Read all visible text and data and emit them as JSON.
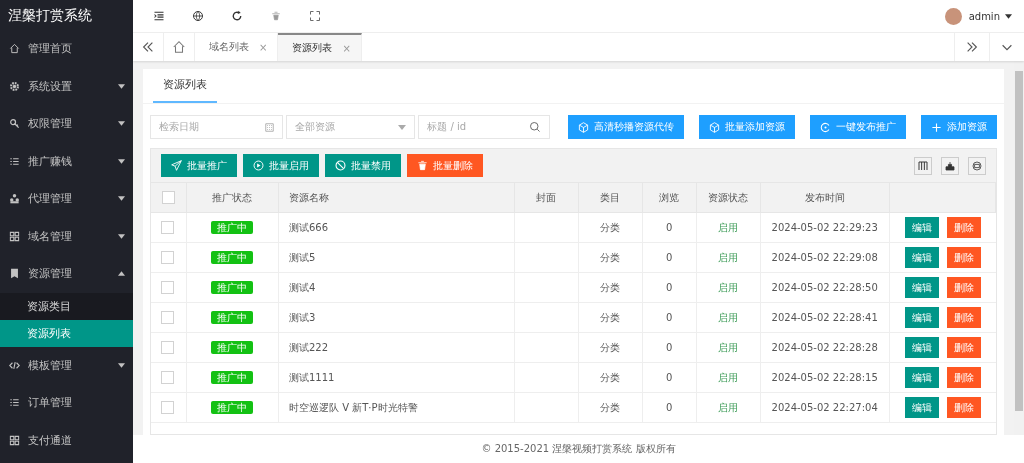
{
  "app_title": "涅槃打赏系统",
  "sidebar": {
    "items": [
      {
        "label": "管理首页",
        "expandable": false,
        "selected": false
      },
      {
        "label": "系统设置",
        "expandable": true,
        "expanded": false,
        "selected": false
      },
      {
        "label": "权限管理",
        "expandable": true,
        "expanded": false,
        "selected": false
      },
      {
        "label": "推广赚钱",
        "expandable": true,
        "expanded": false,
        "selected": false
      },
      {
        "label": "代理管理",
        "expandable": true,
        "expanded": false,
        "selected": false
      },
      {
        "label": "域名管理",
        "expandable": true,
        "expanded": false,
        "selected": false
      },
      {
        "label": "资源管理",
        "expandable": true,
        "expanded": true,
        "selected": false,
        "children": [
          {
            "label": "资源类目",
            "selected": false
          },
          {
            "label": "资源列表",
            "selected": true
          }
        ]
      },
      {
        "label": "模板管理",
        "expandable": true,
        "expanded": false,
        "selected": false
      },
      {
        "label": "订单管理",
        "expandable": false,
        "selected": false
      },
      {
        "label": "支付通道",
        "expandable": false,
        "selected": false
      }
    ]
  },
  "user": {
    "name": "admin"
  },
  "tabs": [
    {
      "label": "域名列表",
      "close": "×",
      "selected": false
    },
    {
      "label": "资源列表",
      "close": "×",
      "selected": true
    }
  ],
  "card_tab": "资源列表",
  "filters": {
    "date_placeholder": "检索日期",
    "category_placeholder": "全部资源",
    "search_placeholder": "标题 / id"
  },
  "actions": [
    "高清秒播资源代传",
    "批量添加资源",
    "一键发布推广",
    "添加资源"
  ],
  "batch_buttons": [
    {
      "label": "批量推广",
      "kind": "normal"
    },
    {
      "label": "批量启用",
      "kind": "normal"
    },
    {
      "label": "批量禁用",
      "kind": "normal"
    },
    {
      "label": "批量删除",
      "kind": "danger"
    }
  ],
  "table": {
    "select_all_checked": false,
    "columns": [
      "推广状态",
      "资源名称",
      "封面",
      "类目",
      "浏览",
      "资源状态",
      "发布时间"
    ],
    "rows": [
      {
        "checked": false,
        "promo": "推广中",
        "name": "测试666",
        "category": "分类",
        "views": "0",
        "status": "启用",
        "time": "2024-05-02 22:29:23",
        "edit": "编辑",
        "delete": "删除"
      },
      {
        "checked": false,
        "promo": "推广中",
        "name": "测试5",
        "category": "分类",
        "views": "0",
        "status": "启用",
        "time": "2024-05-02 22:29:08",
        "edit": "编辑",
        "delete": "删除"
      },
      {
        "checked": false,
        "promo": "推广中",
        "name": "测试4",
        "category": "分类",
        "views": "0",
        "status": "启用",
        "time": "2024-05-02 22:28:50",
        "edit": "编辑",
        "delete": "删除"
      },
      {
        "checked": false,
        "promo": "推广中",
        "name": "测试3",
        "category": "分类",
        "views": "0",
        "status": "启用",
        "time": "2024-05-02 22:28:41",
        "edit": "编辑",
        "delete": "删除"
      },
      {
        "checked": false,
        "promo": "推广中",
        "name": "测试222",
        "category": "分类",
        "views": "0",
        "status": "启用",
        "time": "2024-05-02 22:28:28",
        "edit": "编辑",
        "delete": "删除"
      },
      {
        "checked": false,
        "promo": "推广中",
        "name": "测试1111",
        "category": "分类",
        "views": "0",
        "status": "启用",
        "time": "2024-05-02 22:28:15",
        "edit": "编辑",
        "delete": "删除"
      },
      {
        "checked": false,
        "promo": "推广中",
        "name": "时空巡逻队 V 新T·P时光特警",
        "category": "分类",
        "views": "0",
        "status": "启用",
        "time": "2024-05-02 22:27:04",
        "edit": "编辑",
        "delete": "删除"
      }
    ]
  },
  "footer": "© 2015-2021 涅槃视频打赏系统 版权所有"
}
